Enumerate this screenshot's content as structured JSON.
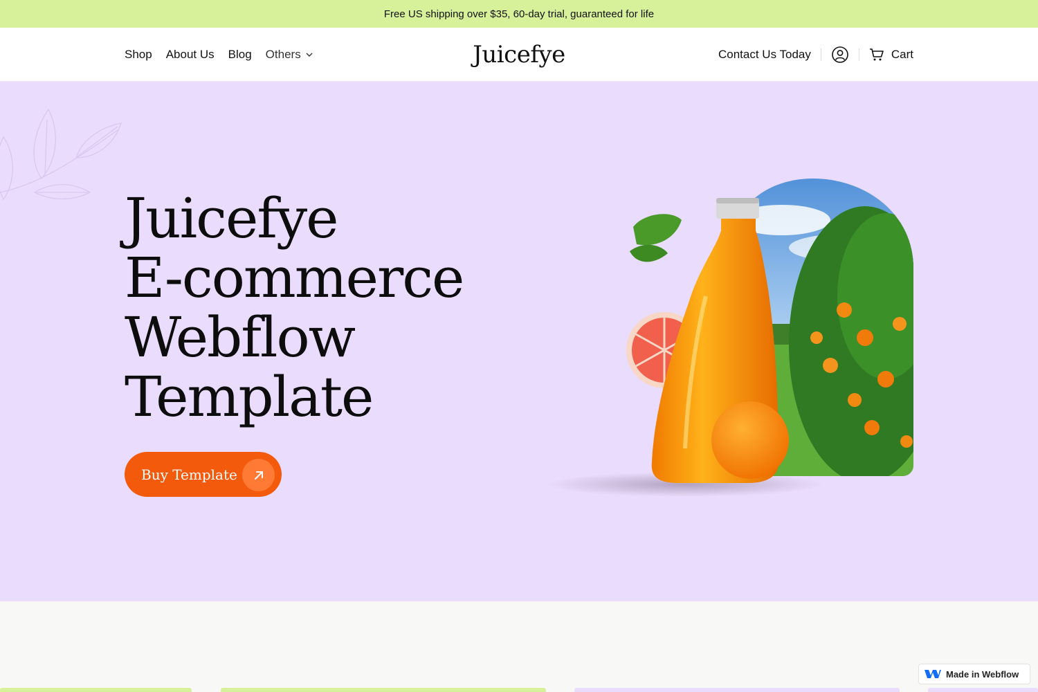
{
  "announcement": "Free US shipping over $35, 60-day trial, guaranteed for life",
  "nav": {
    "links": [
      "Shop",
      "About Us",
      "Blog"
    ],
    "others_label": "Others",
    "logo": "Juicefye",
    "contact_label": "Contact Us Today",
    "account_icon": "user-circle-icon",
    "cart_icon": "cart-icon",
    "cart_label": "Cart"
  },
  "hero": {
    "title_lines": [
      "Juicefye",
      "E-commerce",
      "Webflow",
      "Template"
    ],
    "cta_label": "Buy Template",
    "cta_icon": "arrow-up-right-icon"
  },
  "badge": {
    "label": "Made in Webflow",
    "icon": "webflow-logo-icon"
  },
  "colors": {
    "announcement_bg": "#d7f09a",
    "hero_bg": "#eadcfc",
    "accent": "#f45a0b",
    "lower_bg": "#f8f9f6"
  }
}
